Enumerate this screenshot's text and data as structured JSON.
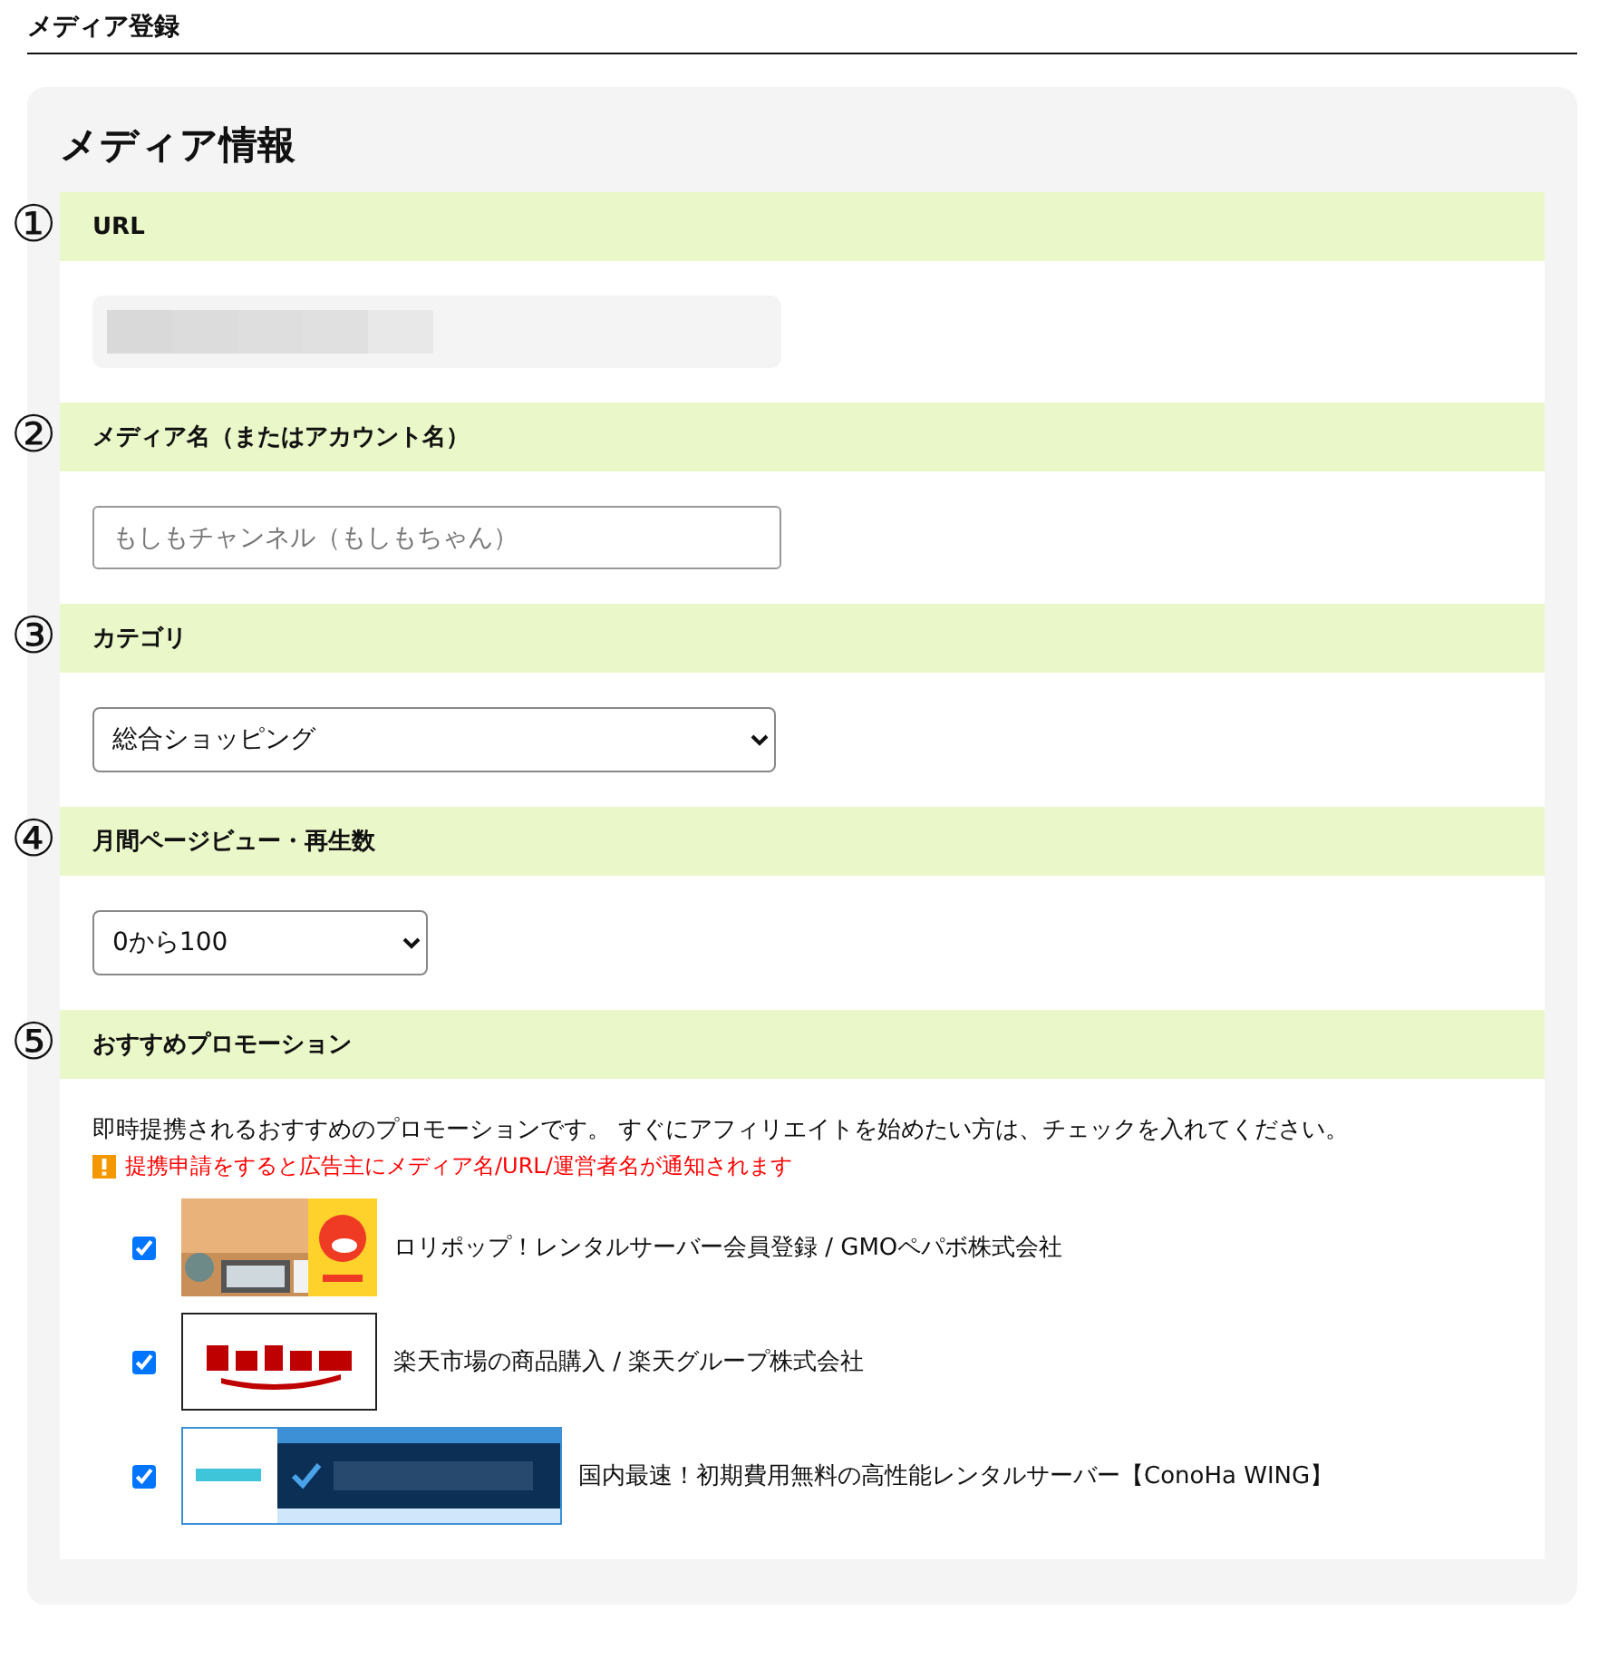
{
  "page_title": "メディア登録",
  "card_title": "メディア情報",
  "sections": [
    {
      "number": "①",
      "title": "URL",
      "kind": "redacted"
    },
    {
      "number": "②",
      "title": "メディア名（またはアカウント名）",
      "kind": "text",
      "placeholder": "もしもチャンネル（もしもちゃん）"
    },
    {
      "number": "③",
      "title": "カテゴリ",
      "kind": "wideselect",
      "value": "総合ショッピング"
    },
    {
      "number": "④",
      "title": "月間ページビュー・再生数",
      "kind": "narrowselect",
      "value": "0から100"
    },
    {
      "number": "⑤",
      "title": "おすすめプロモーション",
      "kind": "promotions"
    }
  ],
  "promotions": {
    "intro": "即時提携されるおすすめのプロモーションです。 すぐにアフィリエイトを始めたい方は、チェックを入れてください。",
    "warning": "提携申請をすると広告主にメディア名/URL/運営者名が通知されます",
    "items": [
      {
        "label": "ロリポップ！レンタルサーバー会員登録 / GMOペパボ株式会社",
        "checked": true
      },
      {
        "label": "楽天市場の商品購入 / 楽天グループ株式会社",
        "checked": true,
        "kind": "logo"
      },
      {
        "label": "国内最速！初期費用無料の高性能レンタルサーバー【ConoHa WING】",
        "checked": true,
        "kind": "banner"
      }
    ]
  }
}
